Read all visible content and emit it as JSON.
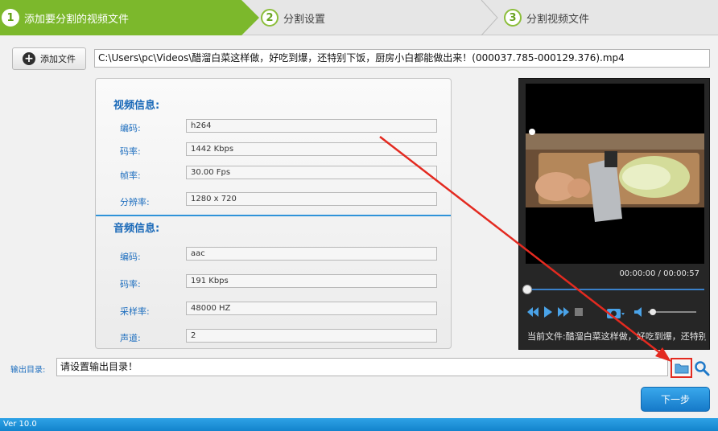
{
  "steps": [
    {
      "num": "1",
      "label": "添加要分割的视频文件"
    },
    {
      "num": "2",
      "label": "分割设置"
    },
    {
      "num": "3",
      "label": "分割视频文件"
    }
  ],
  "add_file": {
    "label": "添加文件"
  },
  "file_path": "C:\\Users\\pc\\Videos\\醋溜白菜这样做，好吃到爆，还特别下饭，厨房小白都能做出来！(000037.785-000129.376).mp4",
  "video_info": {
    "title": "视频信息:",
    "rows": [
      {
        "label": "编码:",
        "value": "h264"
      },
      {
        "label": "码率:",
        "value": "1442 Kbps"
      },
      {
        "label": "帧率:",
        "value": "30.00 Fps"
      },
      {
        "label": "分辨率:",
        "value": "1280 x 720"
      }
    ]
  },
  "audio_info": {
    "title": "音频信息:",
    "rows": [
      {
        "label": "编码:",
        "value": "aac"
      },
      {
        "label": "码率:",
        "value": "191 Kbps"
      },
      {
        "label": "采样率:",
        "value": "48000 HZ"
      },
      {
        "label": "声道:",
        "value": "2"
      }
    ]
  },
  "player": {
    "time": "00:00:00 / 00:00:57",
    "progress": 0,
    "current_file": "当前文件:醋溜白菜这样做，好吃到爆，还特别下饭，厨房小白都能做出来！"
  },
  "output": {
    "label": "输出目录:",
    "value": "请设置输出目录！"
  },
  "next_button": "下一步",
  "status_text": "Ver 10.0",
  "colors": {
    "step_active": "#7cb82c",
    "accent": "#1f7fd0",
    "highlight": "#e32a20"
  }
}
